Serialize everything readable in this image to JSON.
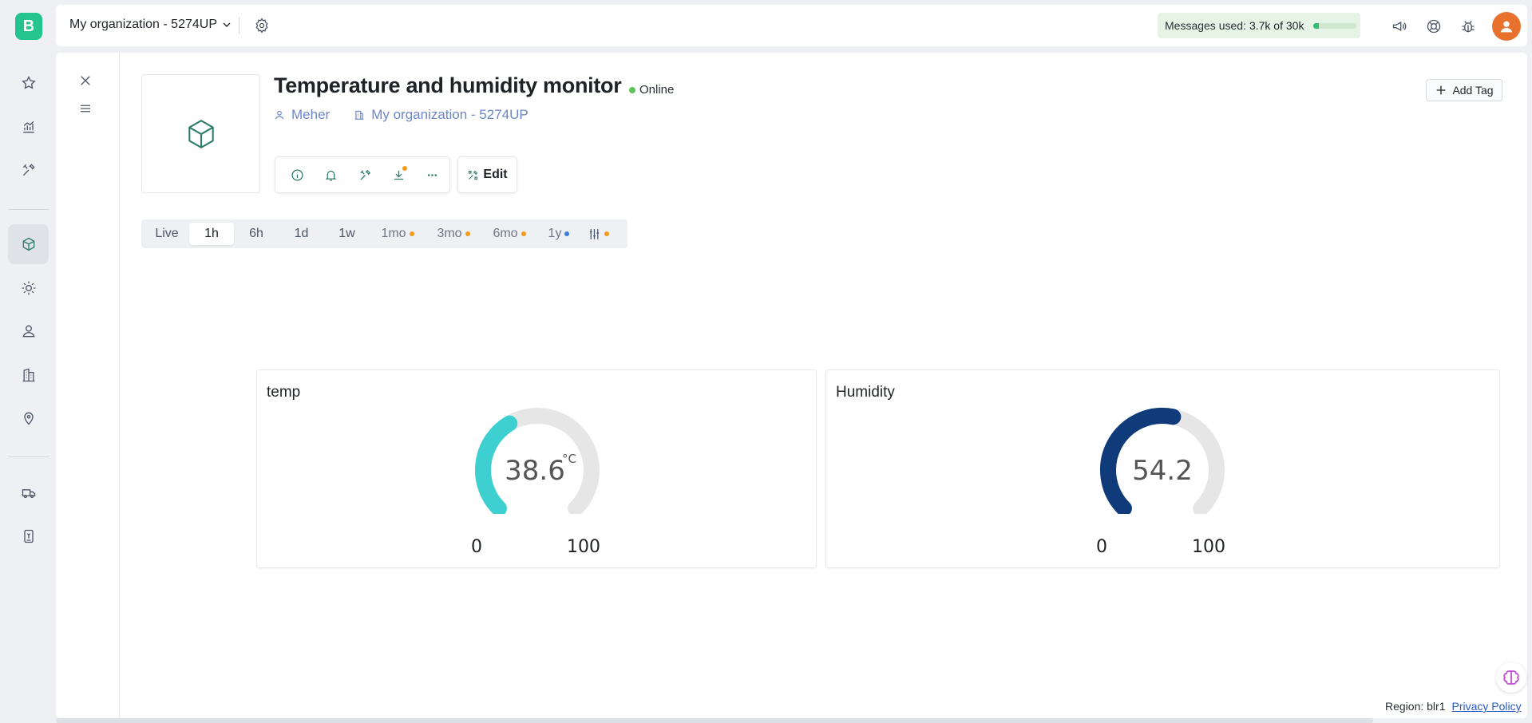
{
  "app": {
    "logo_letter": "B"
  },
  "topbar": {
    "org_name": "My organization - 5274UP",
    "messages_label": "Messages used:",
    "messages_value": "3.7k of 30k",
    "messages_fraction": 0.12
  },
  "device": {
    "title": "Temperature and humidity monitor",
    "status": "Online",
    "owner": "Meher",
    "organization": "My organization - 5274UP",
    "edit_label": "Edit",
    "add_tag_label": "Add Tag"
  },
  "time_ranges": [
    {
      "label": "Live",
      "active": false
    },
    {
      "label": "1h",
      "active": true
    },
    {
      "label": "6h",
      "active": false
    },
    {
      "label": "1d",
      "active": false
    },
    {
      "label": "1w",
      "active": false
    },
    {
      "label": "1mo",
      "dot": "orange"
    },
    {
      "label": "3mo",
      "dot": "orange"
    },
    {
      "label": "6mo",
      "dot": "orange"
    },
    {
      "label": "1y",
      "dot": "blue"
    }
  ],
  "widgets": {
    "temp": {
      "title": "temp",
      "value": "38.6",
      "unit": "°C",
      "min": "0",
      "max": "100",
      "level": 38.6,
      "color": "#3ecfd1"
    },
    "humidity": {
      "title": "Humidity",
      "value": "54.2",
      "unit": "",
      "min": "0",
      "max": "100",
      "level": 54.2,
      "color": "#0f3b7a"
    }
  },
  "footer": {
    "region": "Region: blr1",
    "privacy": "Privacy Policy"
  },
  "colors": {
    "brand": "#23c48e",
    "accent": "#2e7d6b",
    "online": "#5cc35c",
    "badge": "#f39c1e"
  }
}
